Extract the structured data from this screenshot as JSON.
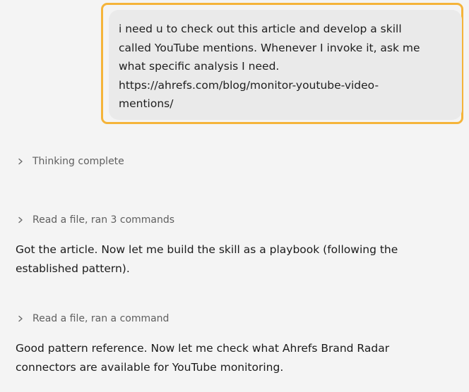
{
  "user_message": {
    "lines": [
      "i need u to check out this article and develop a skill",
      "called YouTube mentions. Whenever I invoke it, ask me",
      "what specific analysis I need.",
      "https://ahrefs.com/blog/monitor-youtube-video-",
      "mentions/"
    ]
  },
  "thinking": {
    "label": "Thinking complete",
    "icon": "chevron-right-icon"
  },
  "activity_1": {
    "label": "Read a file, ran 3 commands",
    "icon": "chevron-right-icon"
  },
  "reply_1": {
    "lines": [
      "Got the article. Now let me build the skill as a playbook (following the",
      "established pattern)."
    ]
  },
  "activity_2": {
    "label": "Read a file, ran a command",
    "icon": "chevron-right-icon"
  },
  "reply_2": {
    "lines": [
      "Good pattern reference. Now let me check what Ahrefs Brand Radar",
      "connectors are available for YouTube monitoring."
    ]
  },
  "colors": {
    "background": "#f4f4f4",
    "user_bubble": "#eaeaea",
    "highlight": "#f5b43a",
    "muted_text": "#5f5f5f",
    "body_text": "#1b1b1b"
  }
}
